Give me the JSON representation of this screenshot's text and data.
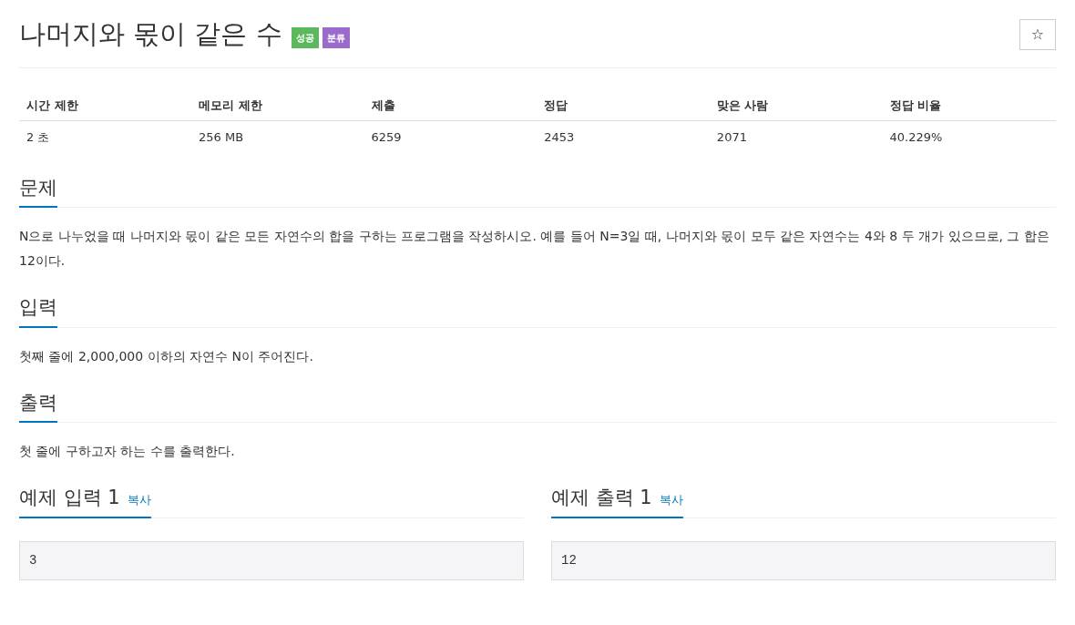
{
  "title": "나머지와 몫이 같은 수",
  "badges": [
    {
      "label": "성공",
      "color": "#5cb85c"
    },
    {
      "label": "분류",
      "color": "#9b6bcc"
    }
  ],
  "star_button": {
    "label": "☆"
  },
  "info_table": {
    "columns": [
      "시간 제한",
      "메모리 제한",
      "제출",
      "정답",
      "맞은 사람",
      "정답 비율"
    ],
    "rows": [
      [
        "2 초",
        "256 MB",
        "6259",
        "2453",
        "2071",
        "40.229%"
      ]
    ]
  },
  "sections": [
    {
      "heading": "문제",
      "body": "N으로 나누었을 때 나머지와 몫이 같은 모든 자연수의 합을 구하는 프로그램을 작성하시오. 예를 들어 N=3일 때, 나머지와 몫이 모두 같은 자연수는 4와 8 두 개가 있으므로, 그 합은 12이다."
    },
    {
      "heading": "입력",
      "body": "첫째 줄에 2,000,000 이하의 자연수 N이 주어진다."
    },
    {
      "heading": "출력",
      "body": "첫 줄에 구하고자 하는 수를 출력한다."
    }
  ],
  "samples": [
    {
      "heading": "예제 입력 1",
      "copy": "복사",
      "content": "3"
    },
    {
      "heading": "예제 출력 1",
      "copy": "복사",
      "content": "12"
    }
  ]
}
